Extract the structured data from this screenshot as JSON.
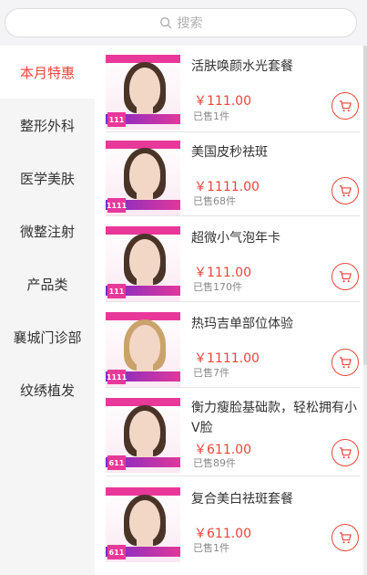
{
  "search": {
    "placeholder": "搜索"
  },
  "sidebar": {
    "items": [
      {
        "label": "本月特惠",
        "active": true
      },
      {
        "label": "整形外科"
      },
      {
        "label": "医学美肤"
      },
      {
        "label": "微整注射"
      },
      {
        "label": "产品类"
      },
      {
        "label": "襄城门诊部"
      },
      {
        "label": "纹绣植发"
      }
    ]
  },
  "products": [
    {
      "title": "活肤唤颜水光套餐",
      "price": "￥111.00",
      "sold": "已售1件",
      "badge": "111"
    },
    {
      "title": "美国皮秒祛斑",
      "price": "￥1111.00",
      "sold": "已售68件",
      "badge": "1111"
    },
    {
      "title": "超微小气泡年卡",
      "price": "￥111.00",
      "sold": "已售170件",
      "badge": "111"
    },
    {
      "title": "热玛吉单部位体验",
      "price": "￥1111.00",
      "sold": "已售7件",
      "badge": "1111"
    },
    {
      "title": "衡力瘦脸基础款，轻松拥有小V脸",
      "price": "￥611.00",
      "sold": "已售89件",
      "badge": "611"
    },
    {
      "title": "复合美白祛斑套餐",
      "price": "￥611.00",
      "sold": "已售1件",
      "badge": "611"
    }
  ],
  "colors": {
    "accent": "#e8463a",
    "promo_pink": "#e8389a"
  }
}
